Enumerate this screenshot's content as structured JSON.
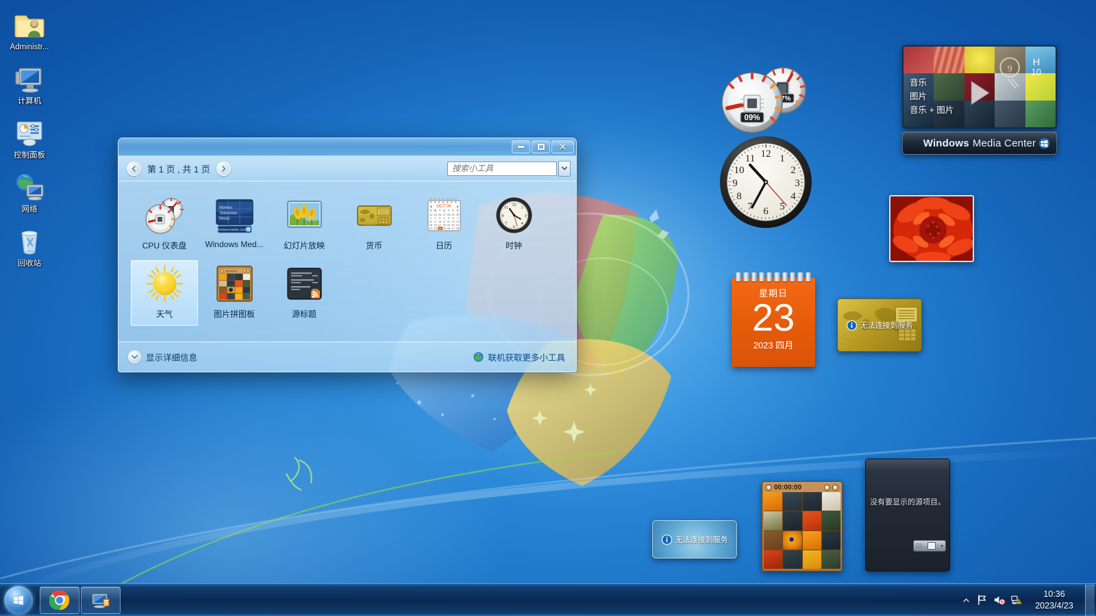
{
  "desktop": {
    "icons": [
      {
        "label": "Administr...",
        "icon": "user-folder-icon"
      },
      {
        "label": "计算机",
        "icon": "computer-icon"
      },
      {
        "label": "控制面板",
        "icon": "control-panel-icon"
      },
      {
        "label": "网络",
        "icon": "network-icon"
      },
      {
        "label": "回收站",
        "icon": "recycle-bin-icon"
      }
    ]
  },
  "gallery": {
    "page_label": "第 1 页 , 共 1 页",
    "prev_icon": "chevron-left-icon",
    "next_icon": "chevron-right-icon",
    "search": {
      "placeholder": "搜索小工具",
      "value": "",
      "icon": "search-icon",
      "dropdown_icon": "chevron-down-icon"
    },
    "window_buttons": {
      "minimize": "最小化",
      "maximize": "最大化",
      "close": "关闭"
    },
    "items": [
      {
        "name": "CPU 仪表盘",
        "icon": "cpu-meter-gadget-icon",
        "selected": false
      },
      {
        "name": "Windows Med...",
        "icon": "media-center-gadget-icon",
        "selected": false
      },
      {
        "name": "幻灯片放映",
        "icon": "slideshow-gadget-icon",
        "selected": false
      },
      {
        "name": "货币",
        "icon": "currency-gadget-icon",
        "selected": false
      },
      {
        "name": "日历",
        "icon": "calendar-gadget-icon",
        "selected": false
      },
      {
        "name": "时钟",
        "icon": "clock-gadget-icon",
        "selected": false
      },
      {
        "name": "天气",
        "icon": "weather-gadget-icon",
        "selected": true
      },
      {
        "name": "图片拼图板",
        "icon": "picture-puzzle-gadget-icon",
        "selected": false
      },
      {
        "name": "源标题",
        "icon": "feed-headlines-gadget-icon",
        "selected": false
      }
    ],
    "status": {
      "details_label": "显示详细信息",
      "details_icon": "chevron-down-circle-icon",
      "online_label": "联机获取更多小工具",
      "online_icon": "globe-icon"
    }
  },
  "gadgets": {
    "cpu_meter": {
      "cpu_value": "09%",
      "memory_value": "47%",
      "name": "CPU 仪表盘"
    },
    "clock": {
      "name": "时钟",
      "hour": 10,
      "minute": 36
    },
    "media_center": {
      "title_bold": "Windows",
      "title_light": "Media Center",
      "options": [
        "音乐",
        "图片",
        "音乐  +  图片"
      ]
    },
    "slideshow": {
      "name": "幻灯片放映"
    },
    "calendar": {
      "day_of_week": "星期日",
      "day": "23",
      "month_year": "2023 四月"
    },
    "currency": {
      "message": "无法连接到服务",
      "icon": "info-icon"
    },
    "weather": {
      "message": "无法连接到服务",
      "icon": "info-icon"
    },
    "picture_puzzle": {
      "timer": "00:00:00",
      "back_icon": "back-icon",
      "help_icon": "help-icon"
    },
    "feed_headlines": {
      "message": "没有要显示的源项目。"
    }
  },
  "taskbar": {
    "start_label": "开始",
    "start_icon": "windows-logo-icon",
    "buttons": [
      {
        "label": "Google Chrome",
        "icon": "chrome-icon"
      },
      {
        "label": "桌面小工具库",
        "icon": "desktop-gadgets-icon"
      }
    ],
    "tray": {
      "overflow_icon": "chevron-up-icon",
      "icons": [
        {
          "name": "action-center-flag-icon"
        },
        {
          "name": "volume-muted-icon"
        },
        {
          "name": "network-warning-icon"
        }
      ],
      "time": "10:36",
      "date": "2023/4/23"
    },
    "show_desktop_label": "显示桌面"
  },
  "colors": {
    "accent": "#1b73c6",
    "calendar_orange": "#e85d0a",
    "taskbar_dark": "#09244c",
    "selection": "#bddffa"
  }
}
